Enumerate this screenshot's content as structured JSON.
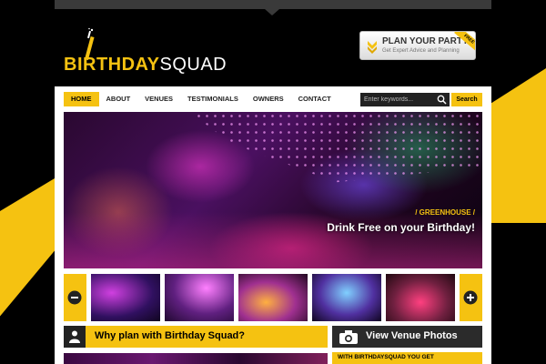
{
  "logo": {
    "part1": "BIRTHDAY",
    "part2": "SQUAD"
  },
  "plan_party": {
    "title": "PLAN YOUR PARTY",
    "subtitle": "Get Expert Advice and Planning",
    "ribbon": "FREE"
  },
  "nav": {
    "items": [
      {
        "label": "HOME",
        "active": true
      },
      {
        "label": "ABOUT",
        "active": false
      },
      {
        "label": "VENUES",
        "active": false
      },
      {
        "label": "TESTIMONIALS",
        "active": false
      },
      {
        "label": "OWNERS",
        "active": false
      },
      {
        "label": "CONTACT",
        "active": false
      }
    ]
  },
  "search": {
    "placeholder": "Enter keywords...",
    "button_label": "Search"
  },
  "hero": {
    "tag": "/ GREENHOUSE /",
    "headline": "Drink Free on your Birthday!"
  },
  "thumbnails": [
    {
      "icon": "venue-thumbnail-1"
    },
    {
      "icon": "venue-thumbnail-2"
    },
    {
      "icon": "venue-thumbnail-3"
    },
    {
      "icon": "venue-thumbnail-4"
    },
    {
      "icon": "venue-thumbnail-5"
    }
  ],
  "why": {
    "title": "Why plan with Birthday Squad?"
  },
  "venue_photos": {
    "label": "View Venue Photos"
  },
  "promo": {
    "text": "WITH BIRTHDAYSQUAD YOU GET"
  },
  "colors": {
    "accent": "#f5c211",
    "dark": "#2b2b2b",
    "background": "#000000"
  }
}
